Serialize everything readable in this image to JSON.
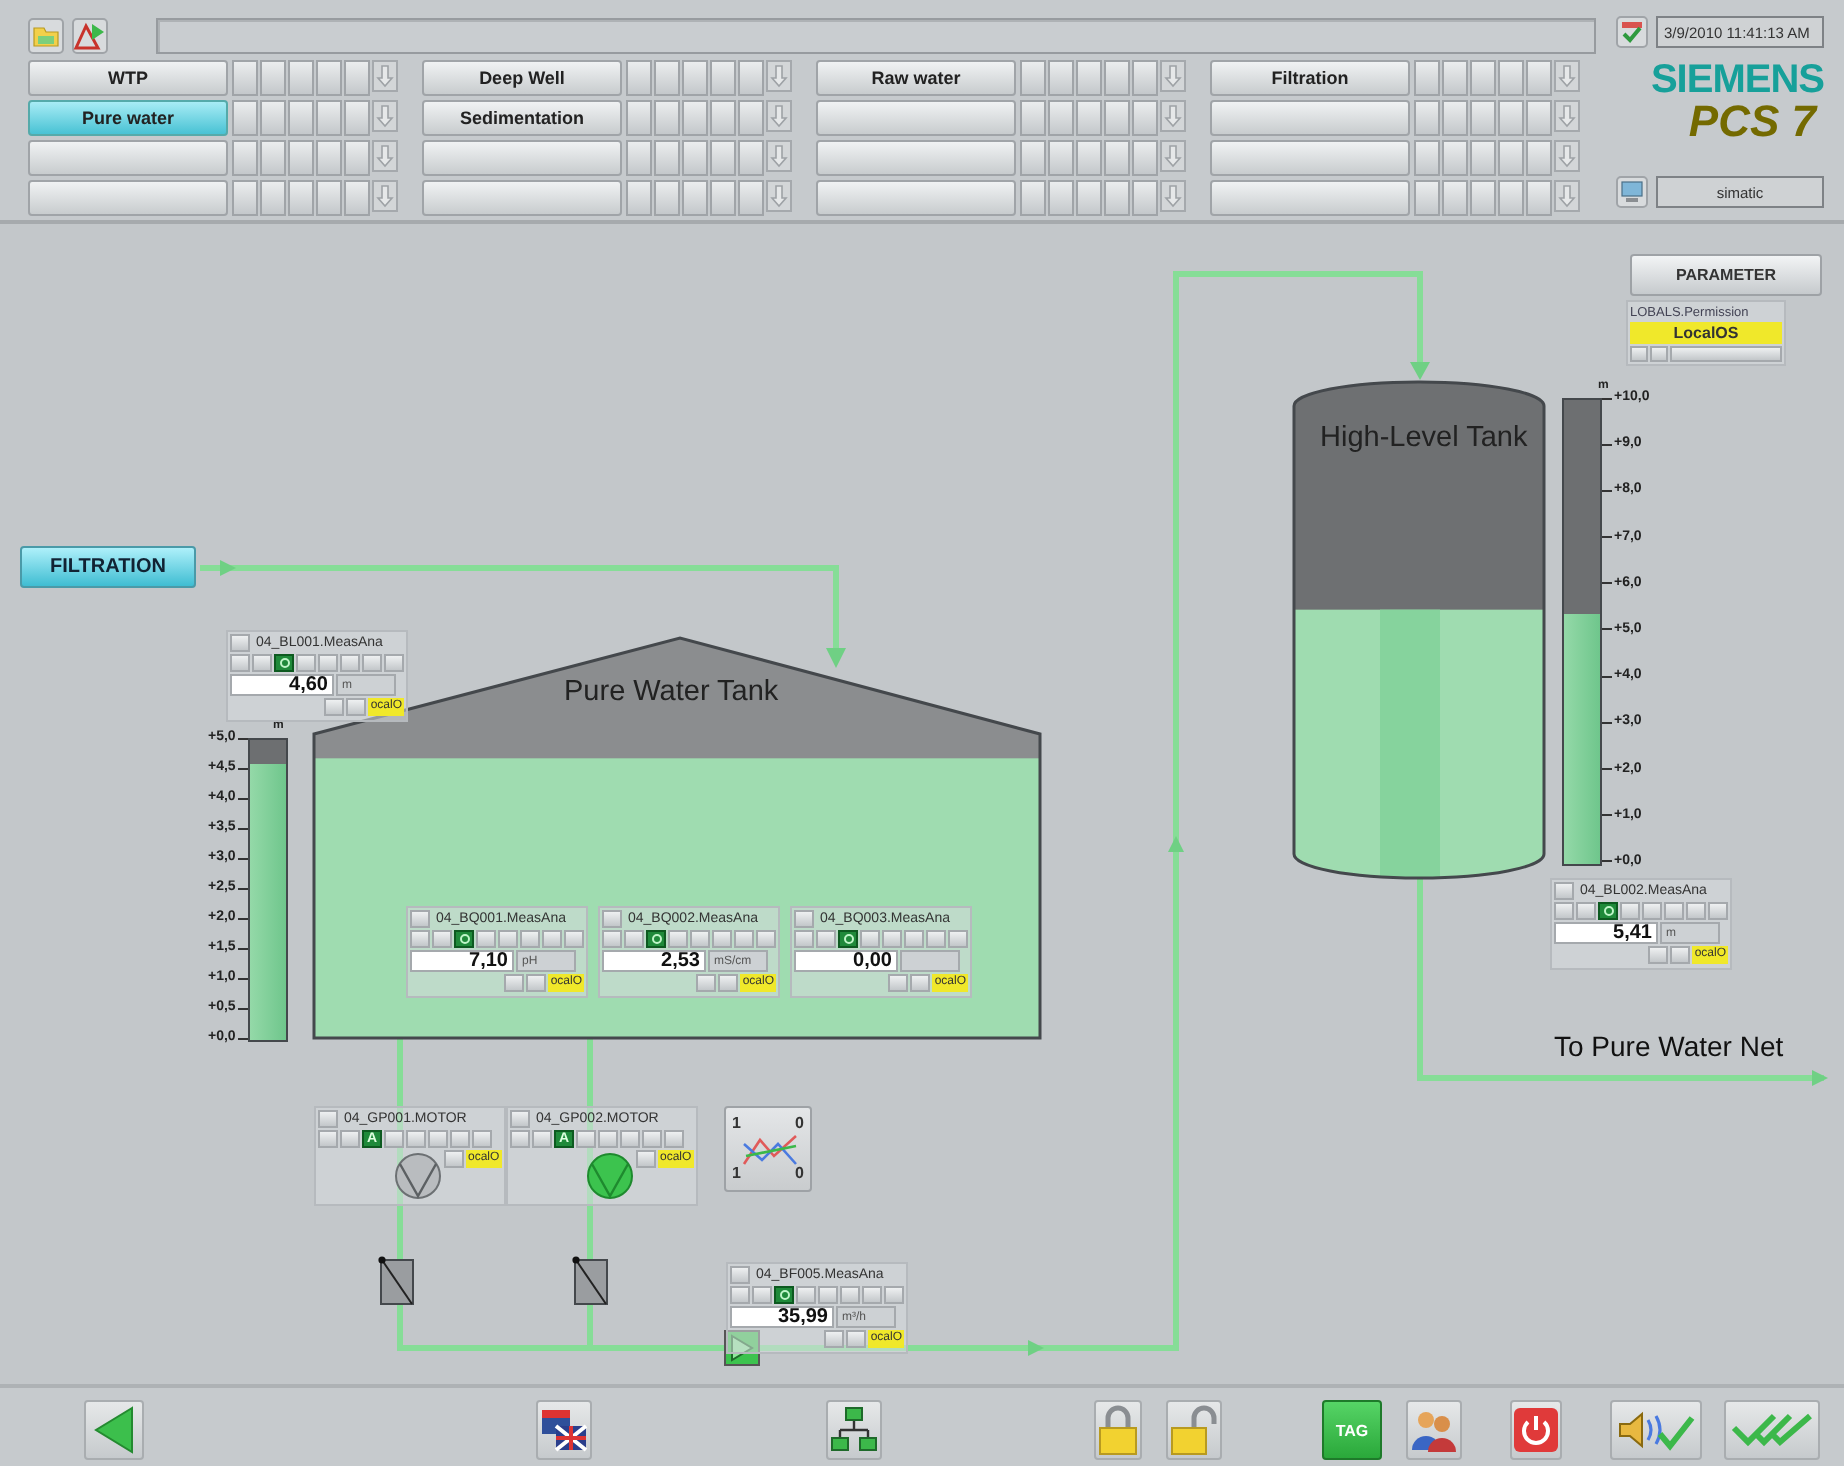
{
  "header": {
    "area_columns": [
      {
        "buttons": [
          {
            "label": "WTP",
            "selected": false
          },
          {
            "label": "Pure water",
            "selected": true
          },
          {
            "selected": false
          },
          {
            "selected": false
          }
        ]
      },
      {
        "buttons": [
          {
            "label": "Deep Well",
            "selected": false
          },
          {
            "label": "Sedimentation",
            "selected": false
          },
          {
            "selected": false
          },
          {
            "selected": false
          }
        ]
      },
      {
        "buttons": [
          {
            "label": "Raw water",
            "selected": false
          },
          {
            "selected": false
          },
          {
            "selected": false
          },
          {
            "selected": false
          }
        ]
      },
      {
        "buttons": [
          {
            "label": "Filtration",
            "selected": false
          },
          {
            "selected": false
          },
          {
            "selected": false
          },
          {
            "selected": false
          }
        ]
      }
    ],
    "datetime": "3/9/2010 11:41:13 AM",
    "brand": "SIEMENS",
    "product": "PCS 7",
    "user": "simatic"
  },
  "parameter_button": "PARAMETER",
  "permission": {
    "tag": "LOBALS.Permission",
    "value": "LocalOS"
  },
  "source_button": "FILTRATION",
  "tanks": [
    {
      "kind": "gable",
      "name": "Pure Water Tank",
      "level": 0.92,
      "unit": "m",
      "ticks": [
        "+5,0",
        "+4,5",
        "+4,0",
        "+3,5",
        "+3,0",
        "+2,5",
        "+2,0",
        "+1,5",
        "+1,0",
        "+0,5",
        "+0,0"
      ]
    },
    {
      "kind": "cylinder",
      "name": "High-Level Tank",
      "level": 0.541,
      "unit": "m",
      "ticks": [
        "+10,0",
        "+9,0",
        "+8,0",
        "+7,0",
        "+6,0",
        "+5,0",
        "+4,0",
        "+3,0",
        "+2,0",
        "+1,0",
        "+0,0"
      ]
    }
  ],
  "measurements": [
    {
      "tag": "04_BL001.MeasAna",
      "value": "4,60",
      "unit": "m",
      "status": "ocalO"
    },
    {
      "tag": "04_BQ001.MeasAna",
      "value": "7,10",
      "unit": "pH",
      "status": "ocalO"
    },
    {
      "tag": "04_BQ002.MeasAna",
      "value": "2,53",
      "unit": "mS/cm",
      "status": "ocalO"
    },
    {
      "tag": "04_BQ003.MeasAna",
      "value": "0,00",
      "status": "ocalO"
    },
    {
      "tag": "04_BL002.MeasAna",
      "value": "5,41",
      "unit": "m",
      "status": "ocalO"
    },
    {
      "tag": "04_BF005.MeasAna",
      "value": "35,99",
      "unit": "m³/h",
      "status": "ocalO"
    }
  ],
  "motors": [
    {
      "tag": "04_GP001.MOTOR",
      "mode": "A",
      "running": false,
      "status": "ocalO"
    },
    {
      "tag": "04_GP002.MOTOR",
      "mode": "A",
      "running": true,
      "status": "ocalO"
    }
  ],
  "trend_button": {
    "labels": [
      "1",
      "0",
      "1",
      "0"
    ]
  },
  "outlet_label": "To Pure Water Net",
  "toolbar": [
    {
      "kind": "back"
    },
    {
      "kind": "language"
    },
    {
      "kind": "network"
    },
    {
      "kind": "lock"
    },
    {
      "kind": "unlock"
    },
    {
      "kind": "tag",
      "label": "TAG"
    },
    {
      "kind": "users"
    },
    {
      "kind": "power"
    },
    {
      "kind": "horn"
    },
    {
      "kind": "ack"
    }
  ]
}
